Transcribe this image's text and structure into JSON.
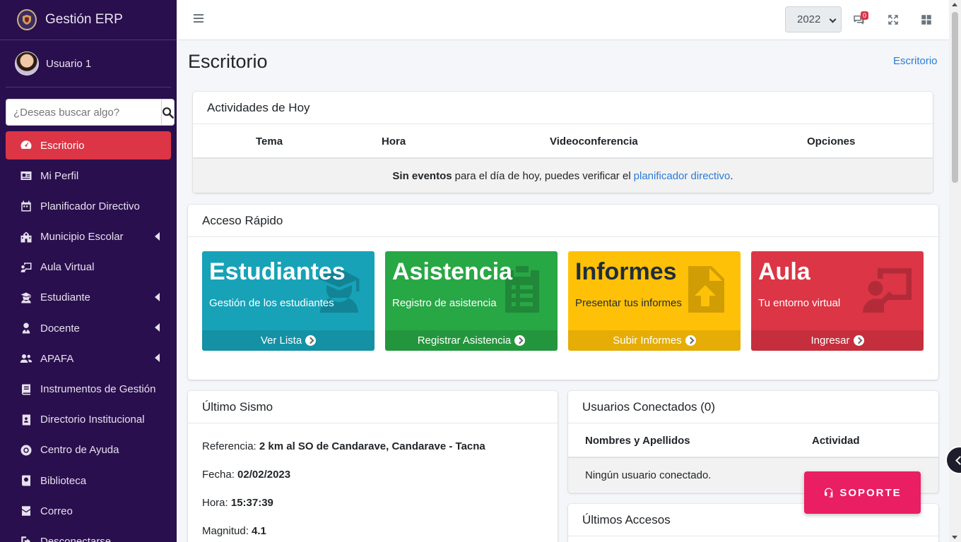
{
  "brand": {
    "name": "Gestión ERP"
  },
  "user": {
    "name": "Usuario 1"
  },
  "search": {
    "placeholder": "¿Deseas buscar algo?"
  },
  "sidebar": {
    "items": [
      {
        "label": "Escritorio",
        "icon": "dashboard-icon",
        "active": true,
        "submenu": false
      },
      {
        "label": "Mi Perfil",
        "icon": "id-card-icon",
        "active": false,
        "submenu": false
      },
      {
        "label": "Planificador Directivo",
        "icon": "calendar-icon",
        "active": false,
        "submenu": false
      },
      {
        "label": "Municipio Escolar",
        "icon": "school-icon",
        "active": false,
        "submenu": true
      },
      {
        "label": "Aula Virtual",
        "icon": "chalkboard-teacher-icon",
        "active": false,
        "submenu": false
      },
      {
        "label": "Estudiante",
        "icon": "graduate-icon",
        "active": false,
        "submenu": true
      },
      {
        "label": "Docente",
        "icon": "user-tie-icon",
        "active": false,
        "submenu": true
      },
      {
        "label": "APAFA",
        "icon": "users-icon",
        "active": false,
        "submenu": true
      },
      {
        "label": "Instrumentos de Gestión",
        "icon": "book-icon",
        "active": false,
        "submenu": false
      },
      {
        "label": "Directorio Institucional",
        "icon": "address-book-icon",
        "active": false,
        "submenu": false
      },
      {
        "label": "Centro de Ayuda",
        "icon": "life-ring-icon",
        "active": false,
        "submenu": false
      },
      {
        "label": "Biblioteca",
        "icon": "library-book-icon",
        "active": false,
        "submenu": false
      },
      {
        "label": "Correo",
        "icon": "mail-icon",
        "active": false,
        "submenu": false
      },
      {
        "label": "Desconectarse",
        "icon": "sign-out-icon",
        "active": false,
        "submenu": false
      }
    ]
  },
  "topbar": {
    "year": "2022",
    "message_count": "0"
  },
  "page": {
    "title": "Escritorio",
    "breadcrumb": "Escritorio"
  },
  "activities": {
    "title": "Actividades de Hoy",
    "columns": [
      "Tema",
      "Hora",
      "Videoconferencia",
      "Opciones"
    ],
    "empty_bold": "Sin eventos",
    "empty_text": "para el día de hoy, puedes verificar el",
    "empty_link": "planificador directivo",
    "empty_end": "."
  },
  "quick_access": {
    "title": "Acceso Rápido",
    "tiles": [
      {
        "title": "Estudiantes",
        "subtitle": "Gestión de los estudiantes",
        "footer": "Ver Lista",
        "color": "#17a2b8",
        "icon": "graduate-icon"
      },
      {
        "title": "Asistencia",
        "subtitle": "Registro de asistencia",
        "footer": "Registrar Asistencia",
        "color": "#28a745",
        "icon": "clipboard-list-icon"
      },
      {
        "title": "Informes",
        "subtitle": "Presentar tus informes",
        "footer": "Subir Informes",
        "color": "#ffc107",
        "icon": "file-upload-icon"
      },
      {
        "title": "Aula",
        "subtitle": "Tu entorno virtual",
        "footer": "Ingresar",
        "color": "#dc3545",
        "icon": "chalkboard-teacher-icon"
      }
    ]
  },
  "sismo": {
    "title": "Último Sismo",
    "referencia_label": "Referencia:",
    "referencia": "2 km al SO de Candarave, Candarave - Tacna",
    "fecha_label": "Fecha:",
    "fecha": "02/02/2023",
    "hora_label": "Hora:",
    "hora": "15:37:39",
    "magnitud_label": "Magnitud:",
    "magnitud": "4.1"
  },
  "connected_users": {
    "title": "Usuarios Conectados (0)",
    "columns": [
      "Nombres y Apellidos",
      "Actividad"
    ],
    "empty": "Ningún usuario conectado."
  },
  "last_access": {
    "title": "Últimos Accesos"
  },
  "support": {
    "label": "SOPORTE"
  }
}
